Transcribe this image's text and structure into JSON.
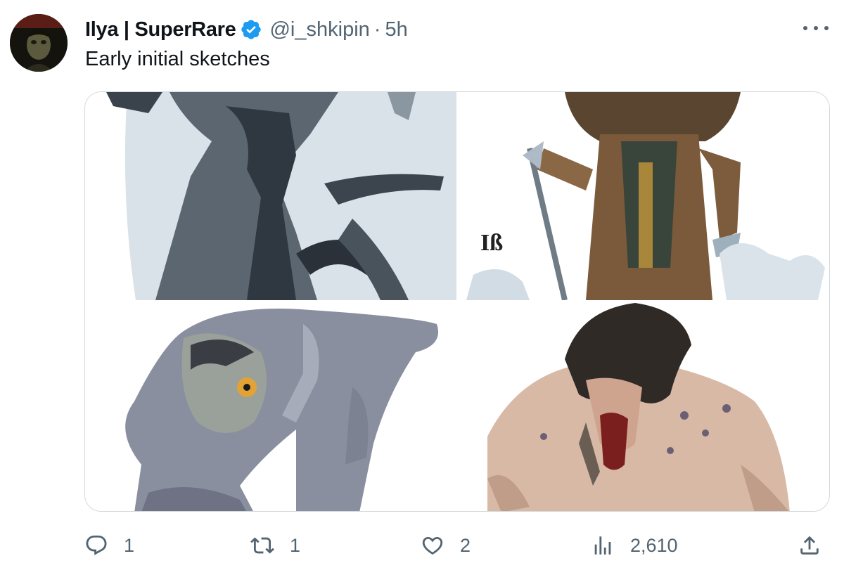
{
  "tweet": {
    "author_name": "Ilya | SuperRare",
    "handle": "@i_shkipin",
    "separator": "·",
    "time": "5h",
    "text": "Early initial sketches"
  },
  "icons": {
    "avatar": "avatar-photo",
    "verified": "verified-badge-icon",
    "more": "more-options-icon",
    "reply": "reply-icon",
    "retweet": "retweet-icon",
    "like": "heart-icon",
    "views": "views-chart-icon",
    "share": "share-icon"
  },
  "media": {
    "images": [
      "armored-warrior-sketch",
      "barbarian-with-wolves-sketch",
      "crouching-goblin-creature-sketch",
      "hairy-beast-sketch"
    ]
  },
  "actions": {
    "reply_count": "1",
    "retweet_count": "1",
    "like_count": "2",
    "views_count": "2,610"
  },
  "colors": {
    "text_primary": "#0f1419",
    "text_secondary": "#536471",
    "verified_blue": "#1d9bf0",
    "border": "#cfd9de"
  }
}
